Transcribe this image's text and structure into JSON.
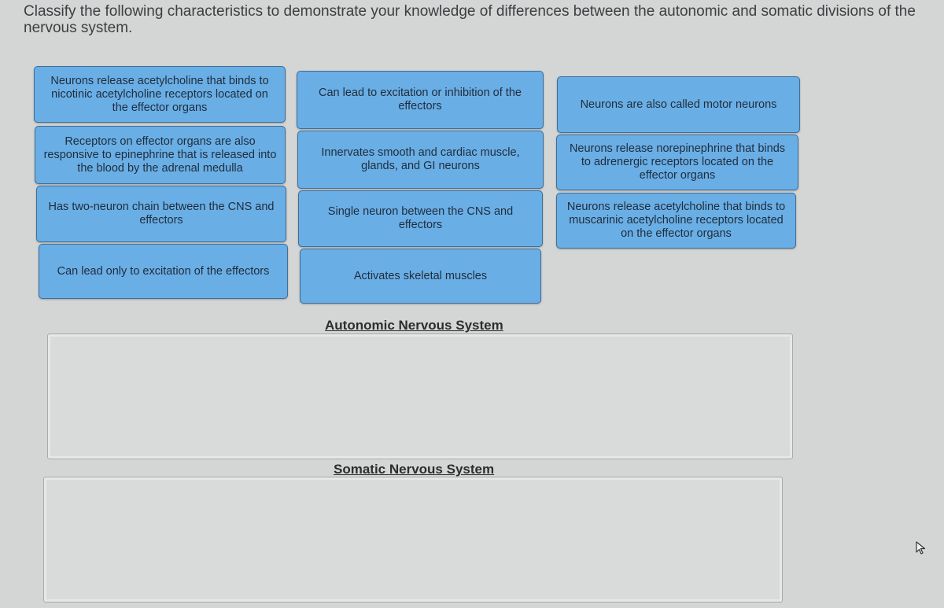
{
  "prompt": "Classify the following characteristics to demonstrate your knowledge of differences between the autonomic and somatic divisions of the nervous system.",
  "cards": [
    "Neurons release acetylcholine that binds to nicotinic acetylcholine receptors located on the effector organs",
    "Receptors on effector organs are also responsive to epinephrine that is released into the blood by the adrenal medulla",
    "Has two-neuron chain between the CNS and effectors",
    "Can lead only to excitation of the effectors",
    "Can lead to excitation or inhibition of the effectors",
    "Innervates smooth and cardiac muscle, glands, and GI neurons",
    "Single neuron between the CNS and effectors",
    "Activates skeletal muscles",
    "Neurons are also called motor neurons",
    "Neurons release norepinephrine that binds to adrenergic receptors located on the effector organs",
    "Neurons release acetylcholine that binds to muscarinic acetylcholine receptors located on the effector organs"
  ],
  "zones": {
    "autonomic": "Autonomic Nervous System",
    "somatic": "Somatic Nervous System"
  },
  "cursor_icon": "mouse-pointer-icon"
}
